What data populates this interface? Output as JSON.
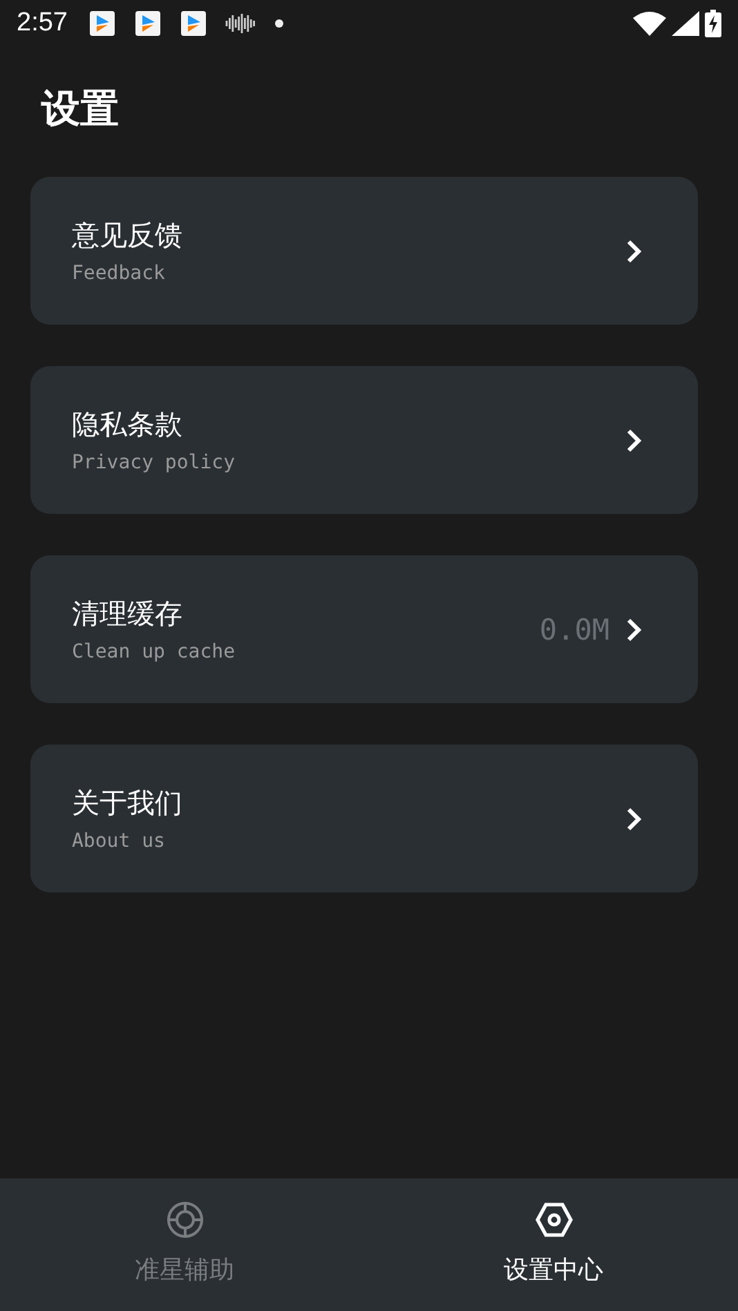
{
  "status_bar": {
    "time": "2:57",
    "notifications": [
      {
        "kind": "app"
      },
      {
        "kind": "app"
      },
      {
        "kind": "app"
      },
      {
        "kind": "waveform"
      },
      {
        "kind": "dot"
      }
    ]
  },
  "title": "设置",
  "items": [
    {
      "title": "意见反馈",
      "subtitle": "Feedback"
    },
    {
      "title": "隐私条款",
      "subtitle": "Privacy policy"
    },
    {
      "title": "清理缓存",
      "subtitle": "Clean up cache",
      "value": "0.0M"
    },
    {
      "title": "关于我们",
      "subtitle": "About us"
    }
  ],
  "nav": [
    {
      "kind": "crosshair",
      "label": "准星辅助",
      "selected": false
    },
    {
      "kind": "settings",
      "label": "设置中心",
      "selected": true
    }
  ]
}
